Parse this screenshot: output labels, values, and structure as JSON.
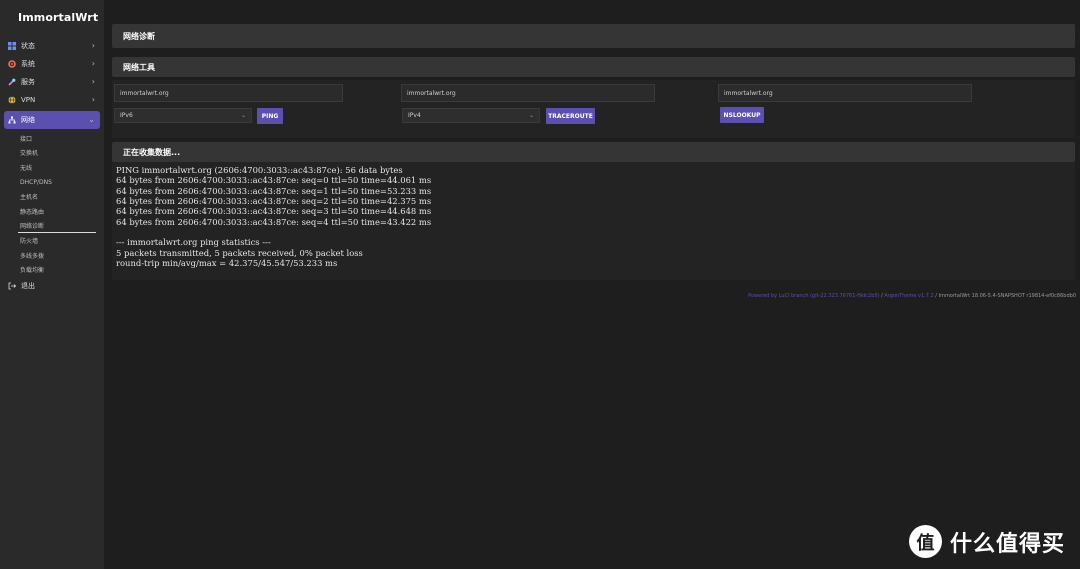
{
  "brand": "ImmortalWrt",
  "sidebar": {
    "items": [
      {
        "label": "状态",
        "icon": "dashboard-icon"
      },
      {
        "label": "系统",
        "icon": "gear-icon"
      },
      {
        "label": "服务",
        "icon": "wrench-icon"
      },
      {
        "label": "VPN",
        "icon": "globe-icon"
      },
      {
        "label": "网络",
        "icon": "network-icon"
      }
    ],
    "network_sub": [
      "接口",
      "交换机",
      "无线",
      "DHCP/DNS",
      "主机名",
      "静态路由",
      "网络诊断",
      "防火墙",
      "多线多拨",
      "负载均衡"
    ],
    "logout": "退出"
  },
  "colors": {
    "accent": "#5b4fb0",
    "background": "#1e1e1e",
    "panel": "#353535"
  },
  "page_title": "网络诊断",
  "tools_title": "网络工具",
  "tools": {
    "ping": {
      "host": "immortalwrt.org",
      "proto": "IPv6",
      "button": "PING"
    },
    "traceroute": {
      "host": "immortalwrt.org",
      "proto": "IPv4",
      "button": "TRACEROUTE"
    },
    "nslookup": {
      "host": "immortalwrt.org",
      "button": "NSLOOKUP"
    }
  },
  "output_title": "正在收集数据...",
  "output_lines": [
    "PING immortalwrt.org (2606:4700:3033::ac43:87ce): 56 data bytes",
    "64 bytes from 2606:4700:3033::ac43:87ce: seq=0 ttl=50 time=44.061 ms",
    "64 bytes from 2606:4700:3033::ac43:87ce: seq=1 ttl=50 time=53.233 ms",
    "64 bytes from 2606:4700:3033::ac43:87ce: seq=2 ttl=50 time=42.375 ms",
    "64 bytes from 2606:4700:3033::ac43:87ce: seq=3 ttl=50 time=44.648 ms",
    "64 bytes from 2606:4700:3033::ac43:87ce: seq=4 ttl=50 time=43.422 ms",
    "",
    "--- immortalwrt.org ping statistics ---",
    "5 packets transmitted, 5 packets received, 0% packet loss",
    "round-trip min/avg/max = 42.375/45.547/53.233 ms"
  ],
  "footer": {
    "luci": "Powered by LuCI branch (git-22.323.76761-f9dc2b5)",
    "sep1": " / ",
    "theme": "ArgonTheme v1.7.2",
    "sep2": " / ",
    "build": "ImmortalWrt 18.06-5.4-SNAPSHOT r19814-ef0c86bdb0"
  },
  "watermark": {
    "glyph": "值",
    "text": "什么值得买"
  }
}
